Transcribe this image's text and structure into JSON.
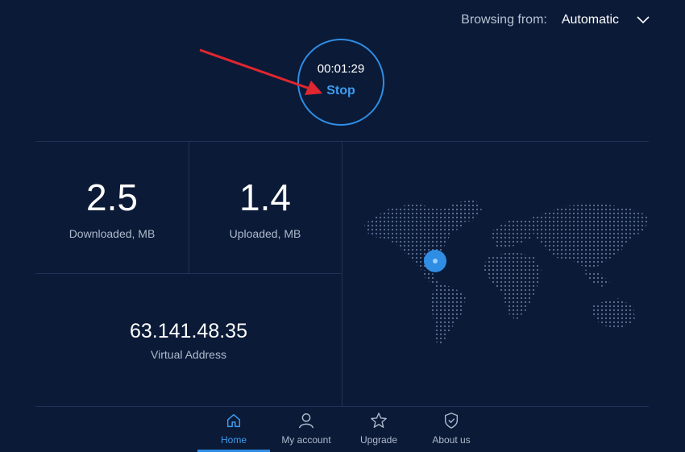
{
  "header": {
    "browsing_label": "Browsing from:",
    "browsing_value": "Automatic",
    "dropdown_icon": "chevron-down-icon"
  },
  "timer": {
    "time": "00:01:29",
    "action": "Stop"
  },
  "stats": {
    "downloaded_value": "2.5",
    "downloaded_caption": "Downloaded, MB",
    "uploaded_value": "1.4",
    "uploaded_caption": "Uploaded, MB",
    "ip_value": "63.141.48.35",
    "ip_caption": "Virtual Address"
  },
  "nav": {
    "items": [
      {
        "label": "Home",
        "icon": "home-icon",
        "active": true
      },
      {
        "label": "My account",
        "icon": "user-icon",
        "active": false
      },
      {
        "label": "Upgrade",
        "icon": "star-icon",
        "active": false
      },
      {
        "label": "About us",
        "icon": "shield-icon",
        "active": false
      }
    ]
  },
  "colors": {
    "background": "#0b1a37",
    "accent": "#2f8de4",
    "divider": "#1e3358",
    "annotation_arrow": "#e0262f"
  }
}
